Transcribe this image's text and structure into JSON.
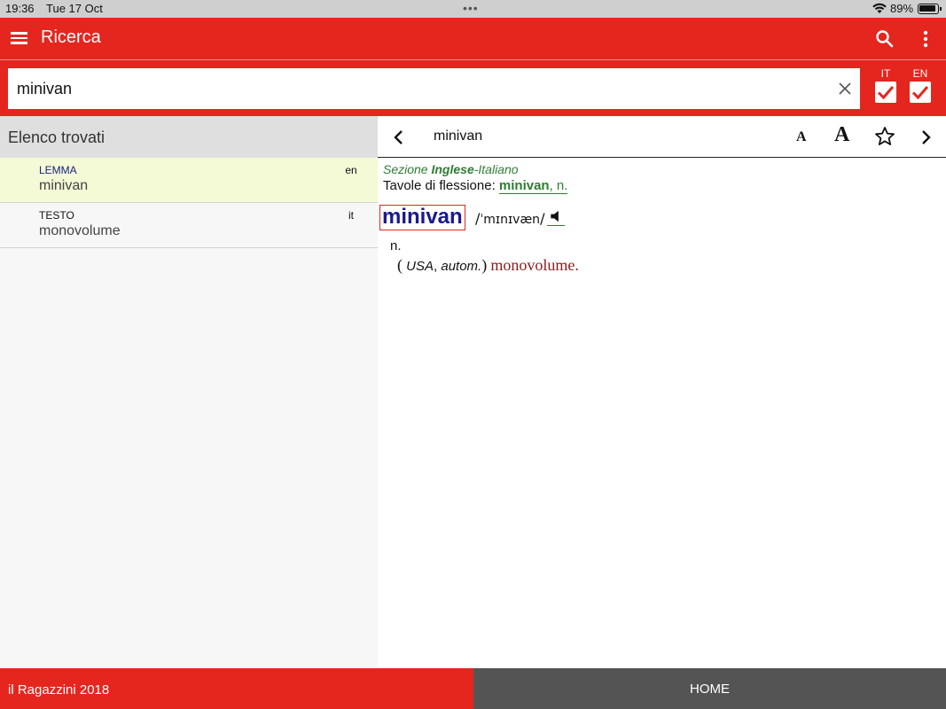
{
  "status_bar": {
    "time": "19:36",
    "date": "Tue 17 Oct",
    "battery": "89%"
  },
  "app_bar": {
    "title": "Ricerca",
    "menu_icon": "hamburger-menu-icon",
    "search_icon": "search-icon",
    "more_icon": "more-vert-icon"
  },
  "search": {
    "value": "minivan",
    "clear_icon": "close-icon",
    "languages": [
      {
        "label": "IT",
        "checked": true
      },
      {
        "label": "EN",
        "checked": true
      }
    ]
  },
  "results": {
    "header": "Elenco trovati",
    "items": [
      {
        "type": "LEMMA",
        "word": "minivan",
        "lang": "en",
        "selected": true
      },
      {
        "type": "TESTO",
        "word": "monovolume",
        "lang": "it",
        "selected": false
      }
    ]
  },
  "detail": {
    "title": "minivan",
    "font_small_label": "A",
    "font_large_label": "A",
    "section_prefix": "Sezione ",
    "section_bold": "Inglese",
    "section_suffix": "-Italiano",
    "inflection_label": "Tavole di flessione: ",
    "inflection_word": "minivan",
    "inflection_pos": ", n.",
    "headword": "minivan",
    "pron_open": "/",
    "pron_ipa": "ˈmɪnɪvæn",
    "pron_close": "/",
    "pos": "n.",
    "sense_open": "(",
    "sense_label_1": "USA",
    "sense_sep": ",",
    "sense_label_2": "autom.",
    "sense_close": ")",
    "translation": "monovolume."
  },
  "footer": {
    "brand": "il Ragazzini 2018",
    "home_label": "HOME"
  },
  "colors": {
    "brand_red": "#e4261f",
    "footer_gray": "#545454",
    "link_green": "#2e7d32",
    "headword_blue": "#1a1a8c",
    "translation_red": "#8b1a1a",
    "selected_row": "#f4f9d6"
  }
}
